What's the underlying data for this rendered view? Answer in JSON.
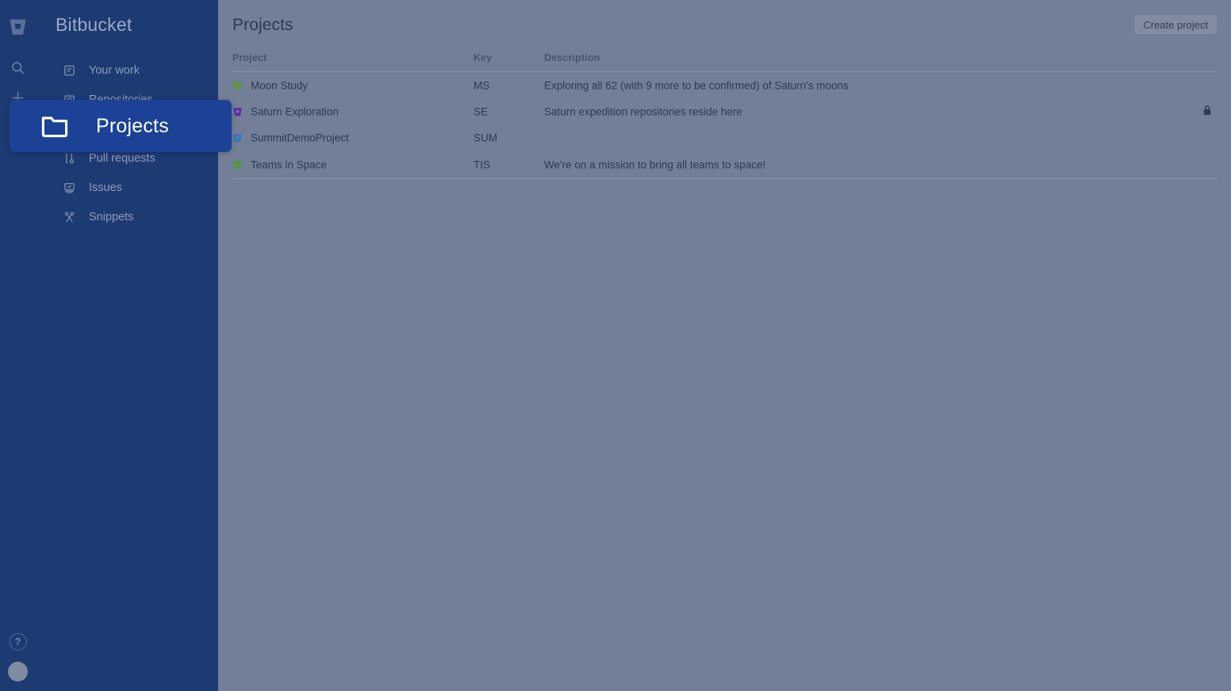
{
  "app": {
    "brand": "Bitbucket",
    "logo_icon": "bitbucket-logo-icon",
    "sidebar_color": "#1d3a72",
    "background_color": "#737f96",
    "highlight_color": "#1b4296"
  },
  "rail": {
    "search_icon": "search-icon",
    "create_icon": "plus-icon",
    "help_icon": "help-icon",
    "help_label": "?",
    "avatar_icon": "avatar-icon"
  },
  "sidebar": {
    "items": [
      {
        "label": "Your work",
        "icon": "your-work-icon"
      },
      {
        "label": "Repositories",
        "icon": "repositories-icon"
      },
      {
        "label": "Projects",
        "icon": "projects-folder-icon"
      },
      {
        "label": "Pull requests",
        "icon": "pull-requests-icon"
      },
      {
        "label": "Issues",
        "icon": "issues-icon"
      },
      {
        "label": "Snippets",
        "icon": "snippets-icon"
      }
    ]
  },
  "spotlight": {
    "label": "Projects",
    "icon": "folder-icon"
  },
  "header": {
    "title": "Projects",
    "create_label": "Create project"
  },
  "table": {
    "columns": [
      "Project",
      "Key",
      "Description"
    ],
    "rows": [
      {
        "name": "Moon Study",
        "key": "MS",
        "description": "Exploring all 62 (with 9 more to be confirmed) of Saturn's moons",
        "icon_color": "#5c9b2e",
        "private": false,
        "lock_icon": ""
      },
      {
        "name": "Saturn Exploration",
        "key": "SE",
        "description": "Saturn expedition repositories reside here",
        "icon_color": "#5f2aa8",
        "private": true,
        "lock_icon": "lock-icon"
      },
      {
        "name": "SummitDemoProject",
        "key": "SUM",
        "description": "",
        "icon_color": "#2a7bbd",
        "private": false,
        "lock_icon": ""
      },
      {
        "name": "Teams in Space",
        "key": "TIS",
        "description": "We're on a mission to bring all teams to space!",
        "icon_color": "#4f9b2e",
        "private": false,
        "lock_icon": ""
      }
    ]
  }
}
